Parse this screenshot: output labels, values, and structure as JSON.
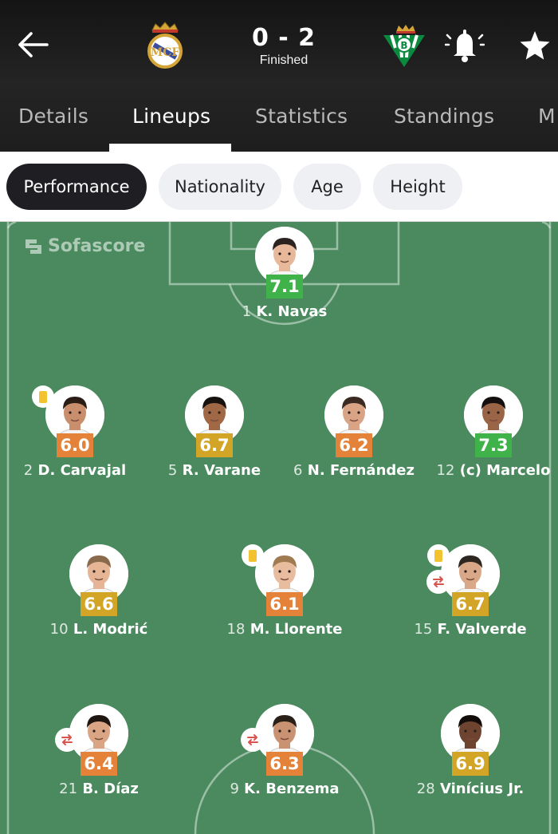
{
  "header": {
    "score": "0 - 2",
    "status": "Finished",
    "back_icon": "arrow-left-icon",
    "notification_icon": "bell-icon",
    "favorite_icon": "star-icon",
    "home_crest": "real-madrid-crest",
    "away_crest": "real-betis-crest"
  },
  "tabs": [
    {
      "label": "Details",
      "active": false
    },
    {
      "label": "Lineups",
      "active": true
    },
    {
      "label": "Statistics",
      "active": false
    },
    {
      "label": "Standings",
      "active": false
    },
    {
      "label": "M",
      "active": false
    }
  ],
  "filters": [
    {
      "label": "Performance",
      "active": true
    },
    {
      "label": "Nationality",
      "active": false
    },
    {
      "label": "Age",
      "active": false
    },
    {
      "label": "Height",
      "active": false
    }
  ],
  "watermark": "Sofascore",
  "colors": {
    "pitch": "#4a8a5e",
    "rating_high": "#3fb24a",
    "rating_mid": "#d3a527",
    "rating_low": "#e4823a",
    "yellow_card": "#f2c230",
    "substitution": "#d9534f"
  },
  "players": [
    {
      "number": "1",
      "name": "K. Navas",
      "rating": "7.1",
      "rating_level": "high",
      "yellow_card": false,
      "substituted": false,
      "skin": "#e7b89a",
      "hair": "#2a2320"
    },
    {
      "number": "2",
      "name": "D. Carvajal",
      "rating": "6.0",
      "rating_level": "low",
      "yellow_card": true,
      "substituted": false,
      "skin": "#c98e6c",
      "hair": "#2a1d16"
    },
    {
      "number": "5",
      "name": "R. Varane",
      "rating": "6.7",
      "rating_level": "mid",
      "yellow_card": false,
      "substituted": false,
      "skin": "#a16846",
      "hair": "#18120f"
    },
    {
      "number": "6",
      "name": "N. Fernández",
      "rating": "6.2",
      "rating_level": "low",
      "yellow_card": false,
      "substituted": false,
      "skin": "#d9a485",
      "hair": "#3a2a22"
    },
    {
      "number": "12",
      "name": "(c) Marcelo",
      "rating": "7.3",
      "rating_level": "high",
      "yellow_card": false,
      "substituted": false,
      "skin": "#9a6446",
      "hair": "#141010"
    },
    {
      "number": "10",
      "name": "L. Modrić",
      "rating": "6.6",
      "rating_level": "mid",
      "yellow_card": false,
      "substituted": false,
      "skin": "#e5b596",
      "hair": "#8a6a4a"
    },
    {
      "number": "18",
      "name": "M. Llorente",
      "rating": "6.1",
      "rating_level": "low",
      "yellow_card": true,
      "substituted": false,
      "skin": "#e8bc9e",
      "hair": "#a07a50"
    },
    {
      "number": "15",
      "name": "F. Valverde",
      "rating": "6.7",
      "rating_level": "mid",
      "yellow_card": true,
      "substituted": true,
      "skin": "#d9a888",
      "hair": "#2e2620"
    },
    {
      "number": "21",
      "name": "B. Díaz",
      "rating": "6.4",
      "rating_level": "low",
      "yellow_card": false,
      "substituted": true,
      "skin": "#d9a585",
      "hair": "#1f1612"
    },
    {
      "number": "9",
      "name": "K. Benzema",
      "rating": "6.3",
      "rating_level": "low",
      "yellow_card": false,
      "substituted": true,
      "skin": "#c99272",
      "hair": "#2a2018"
    },
    {
      "number": "28",
      "name": "Vinícius Jr.",
      "rating": "6.9",
      "rating_level": "mid",
      "yellow_card": false,
      "substituted": false,
      "skin": "#6e4431",
      "hair": "#120d0b"
    }
  ]
}
